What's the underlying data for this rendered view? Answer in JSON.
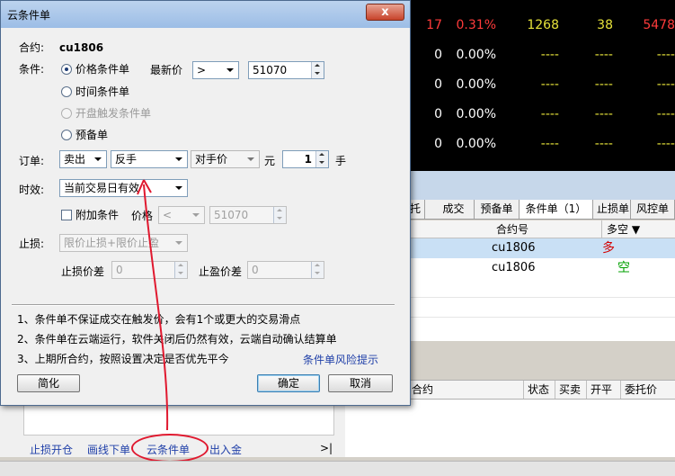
{
  "dialog": {
    "title": "云条件单",
    "close_symbol": "x",
    "contract_label": "合约:",
    "contract_value": "cu1806",
    "condition_label": "条件:",
    "condition_options": [
      "价格条件单",
      "时间条件单",
      "开盘触发条件单",
      "预备单"
    ],
    "last_price_label": "最新价",
    "compare_operator": ">",
    "trigger_price": "51070",
    "order_label": "订单:",
    "direction": "卖出",
    "offset": "反手",
    "price_type": "对手价",
    "currency_unit": "元",
    "quantity": "1",
    "quantity_unit": "手",
    "validity_label": "时效:",
    "validity": "当前交易日有效",
    "extra_condition_label": "附加条件",
    "extra_price_label": "价格",
    "extra_operator": "<",
    "extra_price": "51070",
    "stop_label": "止损:",
    "stop_type": "限价止损+限价止盈",
    "stop_loss_diff_label": "止损价差",
    "stop_loss_diff": "0",
    "take_profit_diff_label": "止盈价差",
    "take_profit_diff": "0",
    "notes": [
      "1、条件单不保证成交在触发价，会有1个或更大的交易滑点",
      "2、条件单在云端运行，软件关闭后仍然有效，云端自动确认结算单",
      "3、上期所合约，按照设置决定是否优先平今"
    ],
    "risk_link": "条件单风险提示",
    "simplify_button": "简化",
    "ok_button": "确定",
    "cancel_button": "取消"
  },
  "quotes": [
    {
      "c1": "17",
      "c2": "0.31%",
      "c3": "1268",
      "c4": "38",
      "c5": "5478"
    },
    {
      "c1": "0",
      "c2": "0.00%",
      "c3": "----",
      "c4": "----",
      "c5": "----"
    },
    {
      "c1": "0",
      "c2": "0.00%",
      "c3": "----",
      "c4": "----",
      "c5": "----"
    },
    {
      "c1": "0",
      "c2": "0.00%",
      "c3": "----",
      "c4": "----",
      "c5": "----"
    },
    {
      "c1": "0",
      "c2": "0.00%",
      "c3": "----",
      "c4": "----",
      "c5": "----"
    }
  ],
  "tabs": [
    "托",
    "成交",
    "预备单",
    "条件单（1）",
    "止损单",
    "风控单"
  ],
  "cond_table": {
    "headers": [
      "合约号",
      "多空 ▼"
    ],
    "rows": [
      {
        "contract": "cu1806",
        "side": "多"
      },
      {
        "contract": "cu1806",
        "side": "空"
      }
    ]
  },
  "order_table_headers": [
    "合约",
    "状态",
    "买卖",
    "开平",
    "委托价"
  ],
  "bottom_links": [
    "止损开仓",
    "画线下单",
    "云条件单",
    "出入金"
  ],
  "nav_end_symbol": ">|",
  "colors": {
    "up": "#ff3b3b",
    "long": "#d40000",
    "short": "#00a000",
    "link": "#1f3fa8",
    "annotation": "#e0192f"
  }
}
